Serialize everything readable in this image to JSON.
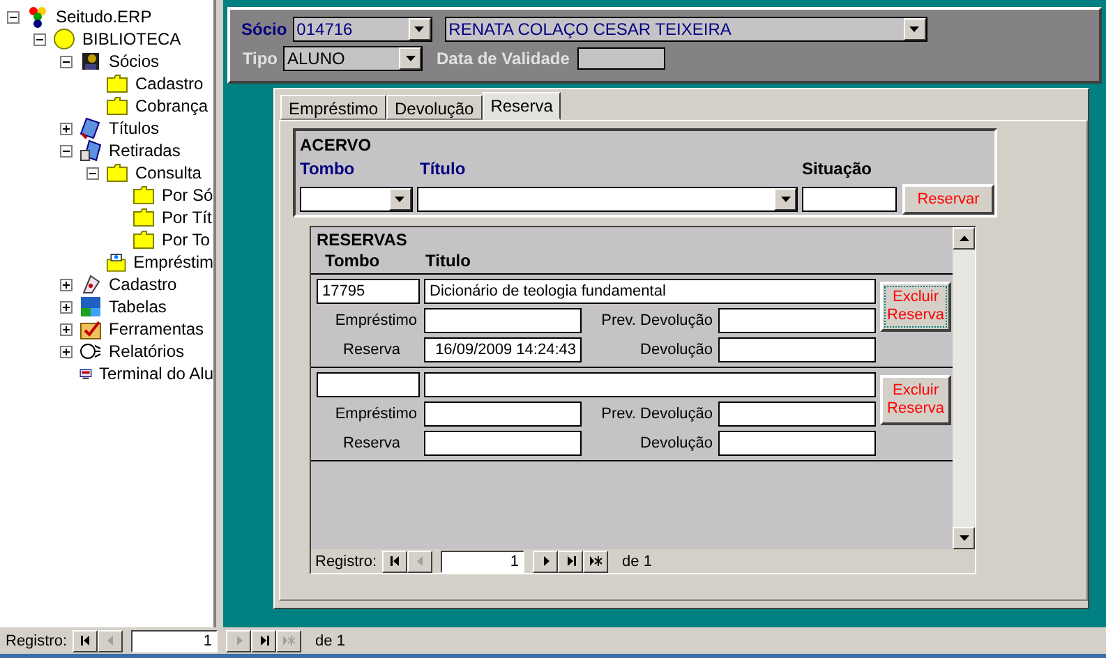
{
  "tree": [
    {
      "label": "Seitudo.ERP",
      "kind": "app",
      "expanded": true,
      "children": [
        {
          "label": "BIBLIOTECA",
          "kind": "library",
          "expanded": true,
          "children": [
            {
              "label": "Sócios",
              "kind": "people",
              "expanded": true,
              "children": [
                {
                  "label": "Cadastro",
                  "kind": "folder"
                },
                {
                  "label": "Cobrança",
                  "kind": "folder"
                }
              ]
            },
            {
              "label": "Títulos",
              "kind": "books",
              "expanded": false
            },
            {
              "label": "Retiradas",
              "kind": "checkout",
              "expanded": true,
              "children": [
                {
                  "label": "Consulta",
                  "kind": "folder",
                  "expanded": true,
                  "children": [
                    {
                      "label": "Por Só",
                      "kind": "folder"
                    },
                    {
                      "label": "Por Tít",
                      "kind": "folder"
                    },
                    {
                      "label": "Por To",
                      "kind": "folder"
                    }
                  ]
                },
                {
                  "label": "Empréstim",
                  "kind": "openfolder"
                }
              ]
            },
            {
              "label": "Cadastro",
              "kind": "stamp",
              "expanded": false
            },
            {
              "label": "Tabelas",
              "kind": "tables",
              "expanded": false
            },
            {
              "label": "Ferramentas",
              "kind": "tools",
              "expanded": false
            },
            {
              "label": "Relatórios",
              "kind": "reports",
              "expanded": false
            },
            {
              "label": "Terminal do Alu",
              "kind": "terminal"
            }
          ]
        }
      ]
    }
  ],
  "header": {
    "socio_label": "Sócio",
    "socio_code": "014716",
    "socio_name": "RENATA COLAÇO  CESAR TEIXEIRA",
    "tipo_label": "Tipo",
    "tipo": "ALUNO",
    "validade_label": "Data de Validade"
  },
  "tabs": [
    {
      "label": "Empréstimo",
      "selected": false
    },
    {
      "label": "Devolução",
      "selected": false
    },
    {
      "label": "Reserva",
      "selected": true
    }
  ],
  "acervo": {
    "title": "ACERVO",
    "tombo_label": "Tombo",
    "titulo_label": "Título",
    "situacao_label": "Situação",
    "button": "Reservar"
  },
  "reservas": {
    "title": "RESERVAS",
    "tombo_label": "Tombo",
    "titulo_label": "Titulo",
    "records": [
      {
        "tombo": "17795",
        "titulo": "Dicionário de teologia fundamental",
        "emprestimo_label": "Empréstimo",
        "prev_label": "Prev. Devolução",
        "reserva_label": "Reserva",
        "reserva": "16/09/2009 14:24:43",
        "devolucao_label": "Devolução",
        "button": "Excluir Reserva",
        "focused": true
      },
      {
        "emprestimo_label": "Empréstimo",
        "prev_label": "Prev. Devolução",
        "reserva_label": "Reserva",
        "devolucao_label": "Devolução",
        "button": "Excluir Reserva",
        "focused": false
      }
    ],
    "nav": {
      "label": "Registro:",
      "current": "1",
      "total": "de 1",
      "buttons": [
        {
          "kind": "first",
          "disabled": false
        },
        {
          "kind": "prev",
          "disabled": true
        },
        {
          "kind": "next",
          "disabled": false
        },
        {
          "kind": "last",
          "disabled": false
        },
        {
          "kind": "new",
          "disabled": false
        }
      ]
    }
  },
  "status_nav": {
    "label": "Registro:",
    "current": "1",
    "total": "de 1",
    "buttons": [
      {
        "kind": "first",
        "disabled": false
      },
      {
        "kind": "prev",
        "disabled": true
      },
      {
        "kind": "next",
        "disabled": true
      },
      {
        "kind": "last",
        "disabled": false
      },
      {
        "kind": "new",
        "disabled": true
      }
    ]
  }
}
